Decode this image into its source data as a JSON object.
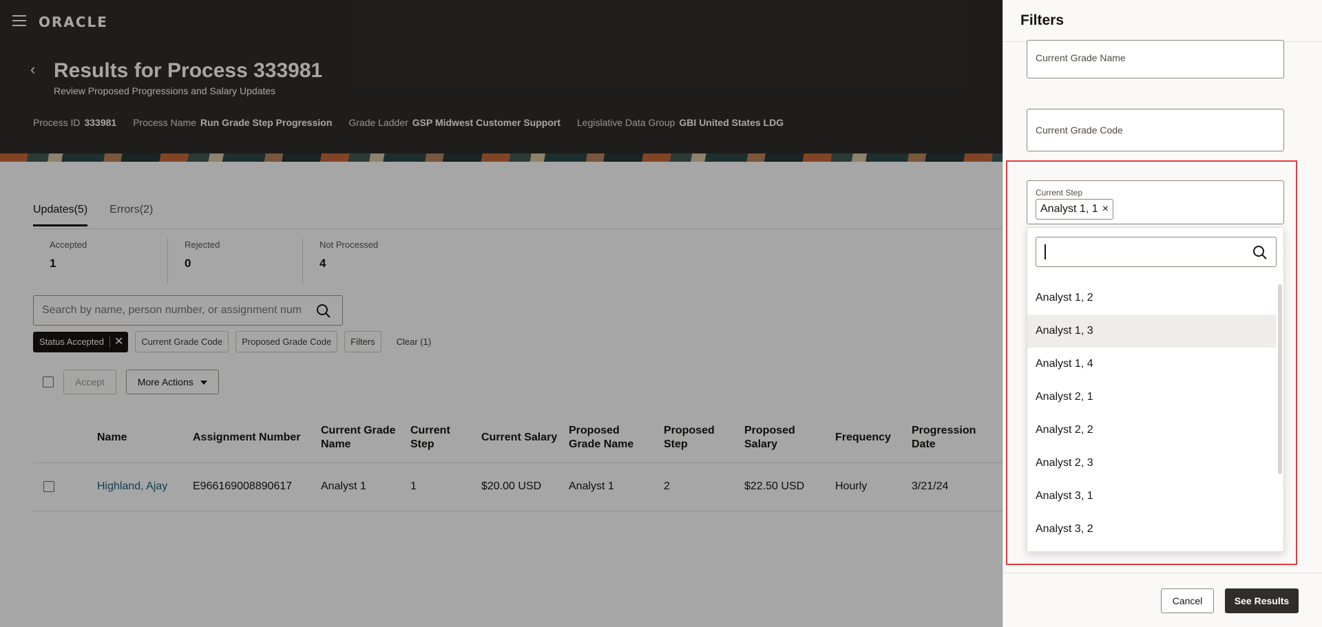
{
  "header": {
    "logo": "ORACLE",
    "title": "Results for Process 333981",
    "subtitle": "Review Proposed Progressions and Salary Updates",
    "meta": [
      {
        "key": "Process ID",
        "value": "333981"
      },
      {
        "key": "Process Name",
        "value": "Run Grade Step Progression"
      },
      {
        "key": "Grade Ladder",
        "value": "GSP Midwest Customer Support"
      },
      {
        "key": "Legislative Data Group",
        "value": "GBI United States LDG"
      }
    ]
  },
  "tabs": [
    "Updates(5)",
    "Errors(2)"
  ],
  "stats": [
    {
      "label": "Accepted",
      "value": "1"
    },
    {
      "label": "Rejected",
      "value": "0"
    },
    {
      "label": "Not Processed",
      "value": "4"
    }
  ],
  "search": {
    "placeholder": "Search by name, person number, or assignment num"
  },
  "chips": {
    "active": "Status Accepted",
    "others": [
      "Current Grade Code",
      "Proposed Grade Code",
      "Filters"
    ],
    "clear": "Clear (1)"
  },
  "actions": {
    "accept": "Accept",
    "more": "More Actions"
  },
  "table": {
    "headers": [
      "Name",
      "Assignment Number",
      "Current Grade Name",
      "Current Step",
      "Current Salary",
      "Proposed Grade Name",
      "Proposed Step",
      "Proposed Salary",
      "Frequency",
      "Progression Date"
    ],
    "rows": [
      [
        "Highland, Ajay",
        "E966169008890617",
        "Analyst 1",
        "1",
        "$20.00 USD",
        "Analyst 1",
        "2",
        "$22.50 USD",
        "Hourly",
        "3/21/24"
      ]
    ]
  },
  "drawer": {
    "title": "Filters",
    "current_grade_name": "Current Grade Name",
    "current_grade_code": "Current Grade Code",
    "current_step_label": "Current Step",
    "selected_step": "Analyst 1, 1",
    "options": [
      "Analyst 1, 2",
      "Analyst 1, 3",
      "Analyst 1, 4",
      "Analyst 2, 1",
      "Analyst 2, 2",
      "Analyst 2, 3",
      "Analyst 3, 1",
      "Analyst 3, 2"
    ],
    "cancel": "Cancel",
    "see_results": "See Results"
  },
  "colors": {
    "header_bg": "#312d2a",
    "link": "#22607a",
    "highlight": "#e53b3b"
  }
}
